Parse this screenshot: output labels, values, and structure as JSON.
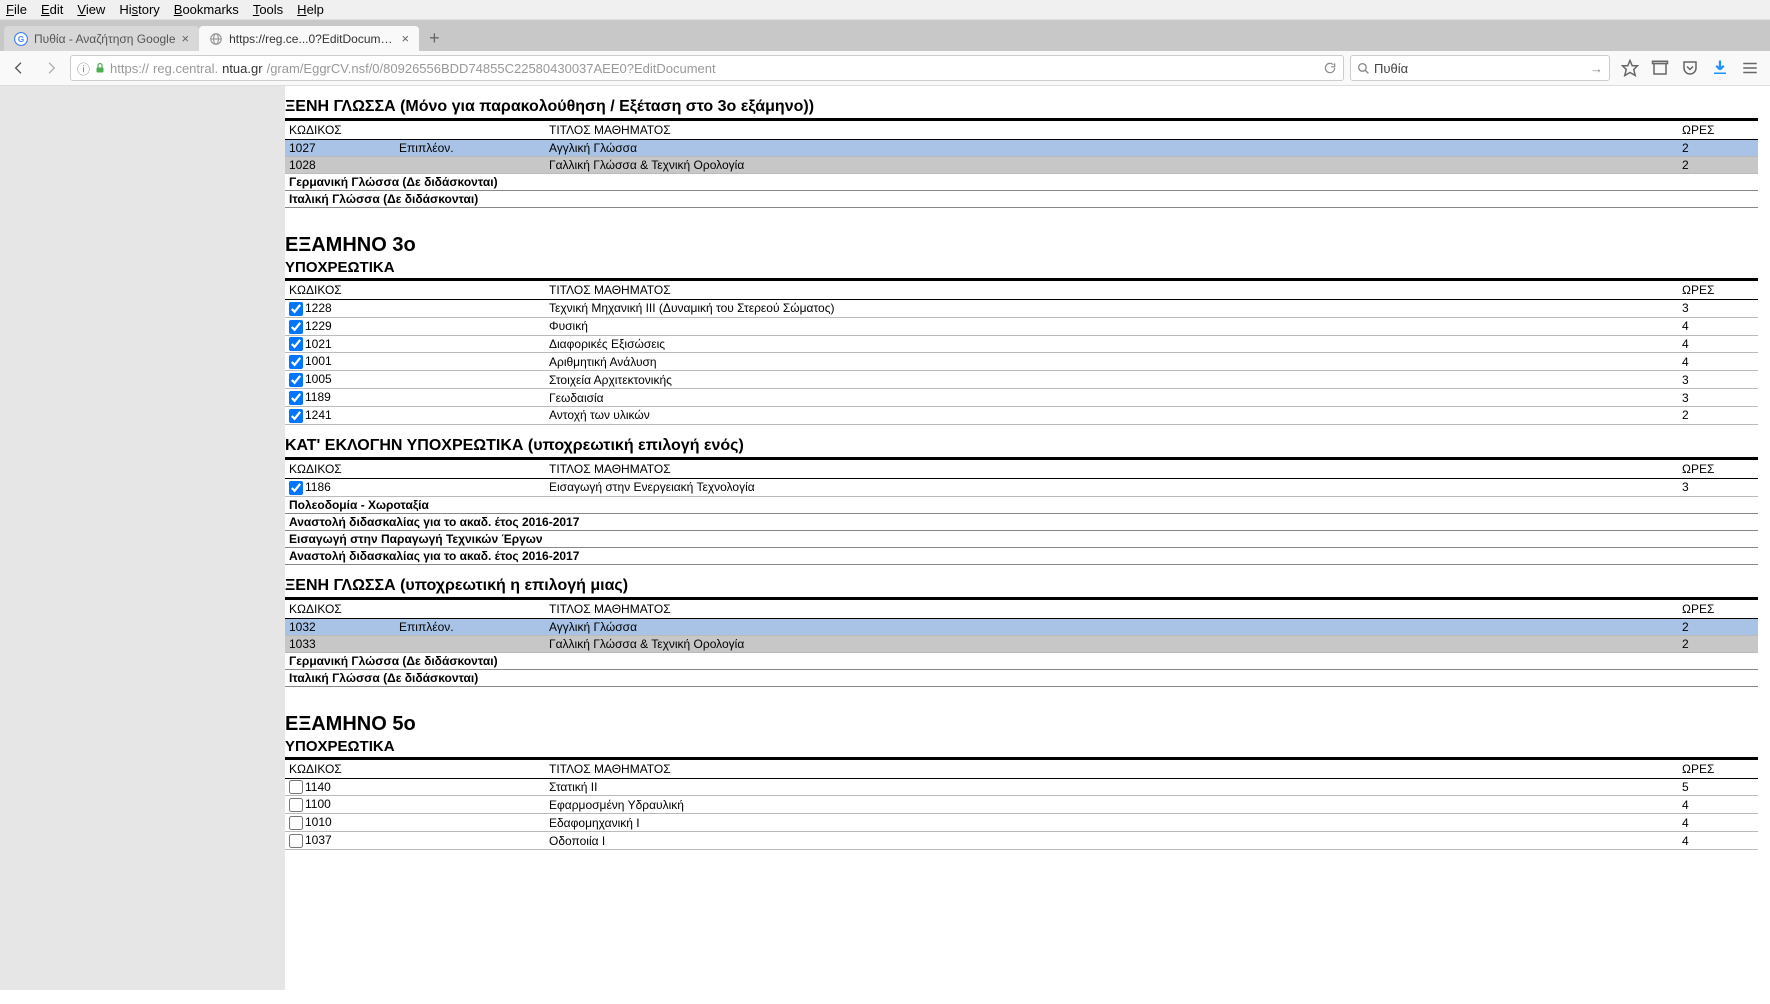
{
  "menu": {
    "file": "File",
    "edit": "Edit",
    "view": "View",
    "history": "History",
    "bookmarks": "Bookmarks",
    "tools": "Tools",
    "help": "Help"
  },
  "tabs": {
    "tab1": "Πυθία - Αναζήτηση Google",
    "tab2": "https://reg.ce...0?EditDocument"
  },
  "url": {
    "proto": "https://",
    "pre": "reg.central.",
    "host": "ntua.gr",
    "path": "/gram/EggrCV.nsf/0/80926556BDD74855C22580430037AEE0?EditDocument"
  },
  "search": {
    "value": "Πυθία"
  },
  "hdr": {
    "code": "ΚΩΔΙΚΟΣ",
    "title": "ΤΙΤΛΟΣ ΜΑΘΗΜΑΤΟΣ",
    "hours": "ΩΡΕΣ",
    "extra": "Επιπλέον."
  },
  "sec1": {
    "title": "ΞΕΝΗ ΓΛΩΣΣΑ (Μόνο για παρακολούθηση / Εξέταση στο 3ο εξάμηνο))",
    "rows": [
      {
        "c": "1027",
        "extra": "Επιπλέον.",
        "t": "Αγγλική Γλώσσα",
        "h": "2"
      },
      {
        "c": "1028",
        "extra": "",
        "t": "Γαλλική Γλώσσα & Τεχνική Ορολογία",
        "h": "2"
      }
    ],
    "notes": [
      "Γερμανική Γλώσσα (Δε διδάσκονται)",
      "Ιταλική Γλώσσα (Δε διδάσκονται)"
    ]
  },
  "sem3": {
    "heading": "ΕΞΑΜΗΝΟ 3ο",
    "mand": "ΥΠΟΧΡΕΩΤΙΚΑ",
    "rows": [
      {
        "c": "1228",
        "t": "Τεχνική Μηχανική ΙΙΙ (Δυναμική του Στερεού Σώματος)",
        "h": "3",
        "chk": true
      },
      {
        "c": "1229",
        "t": "Φυσική",
        "h": "4",
        "chk": true
      },
      {
        "c": "1021",
        "t": "Διαφορικές Εξισώσεις",
        "h": "4",
        "chk": true
      },
      {
        "c": "1001",
        "t": "Αριθμητική Ανάλυση",
        "h": "4",
        "chk": true
      },
      {
        "c": "1005",
        "t": "Στοιχεία Αρχιτεκτονικής",
        "h": "3",
        "chk": true
      },
      {
        "c": "1189",
        "t": "Γεωδαισία",
        "h": "3",
        "chk": true
      },
      {
        "c": "1241",
        "t": "Αντοχή των υλικών",
        "h": "2",
        "chk": true
      }
    ],
    "elect": "ΚΑΤ' ΕΚΛΟΓΗΝ ΥΠΟΧΡΕΩΤΙΚΑ (υποχρεωτική επιλογή ενός)",
    "erows": [
      {
        "c": "1186",
        "t": "Εισαγωγή στην Ενεργειακή Τεχνολογία",
        "h": "3",
        "chk": true
      }
    ],
    "notes": [
      "Πολεοδομία - Χωροταξία",
      "Αναστολή διδασκαλίας για το ακαδ. έτος 2016-2017",
      "Εισαγωγή στην Παραγωγή Τεχνικών Έργων",
      "Αναστολή διδασκαλίας για το ακαδ. έτος 2016-2017"
    ],
    "lang": "ΞΕΝΗ ΓΛΩΣΣΑ (υποχρεωτική η επιλογή μιας)",
    "lrows": [
      {
        "c": "1032",
        "extra": "Επιπλέον.",
        "t": "Αγγλική Γλώσσα",
        "h": "2"
      },
      {
        "c": "1033",
        "extra": "",
        "t": "Γαλλική Γλώσσα & Τεχνική Ορολογία",
        "h": "2"
      }
    ],
    "lnotes": [
      "Γερμανική Γλώσσα (Δε διδάσκονται)",
      "Ιταλική Γλώσσα (Δε διδάσκονται)"
    ]
  },
  "sem5": {
    "heading": "ΕΞΑΜΗΝΟ 5ο",
    "mand": "ΥΠΟΧΡΕΩΤΙΚΑ",
    "rows": [
      {
        "c": "1140",
        "t": "Στατική ΙΙ",
        "h": "5",
        "chk": false
      },
      {
        "c": "1100",
        "t": "Εφαρμοσμένη Υδραυλική",
        "h": "4",
        "chk": false
      },
      {
        "c": "1010",
        "t": "Εδαφομηχανική Ι",
        "h": "4",
        "chk": false
      },
      {
        "c": "1037",
        "t": "Οδοποιία Ι",
        "h": "4",
        "chk": false
      }
    ]
  }
}
